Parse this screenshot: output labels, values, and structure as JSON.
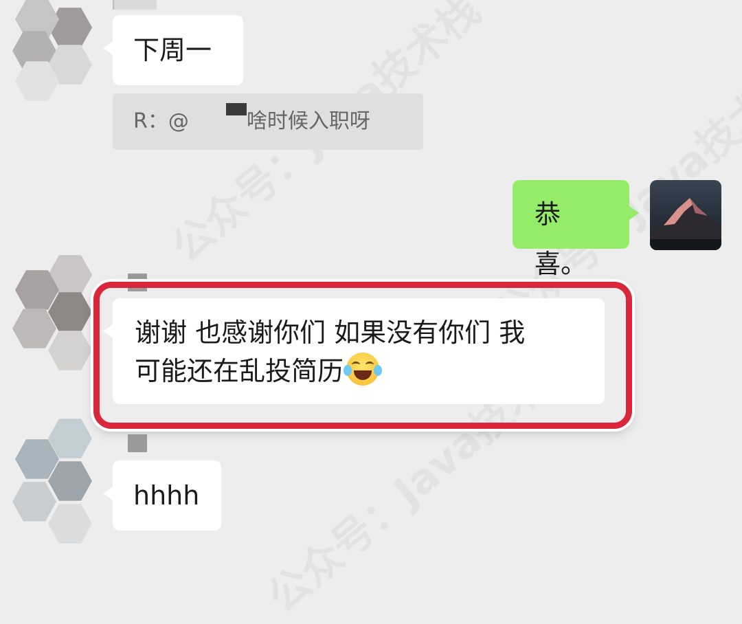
{
  "watermark": {
    "text": "公众号：Java技术栈"
  },
  "messages": {
    "msg1": {
      "text": "下周一"
    },
    "quote": {
      "prefix": "R：@",
      "text": "啥时候入职呀"
    },
    "msg2": {
      "text": "恭喜。"
    },
    "msg3": {
      "line1": "谢谢  也感谢你们  如果没有你们 我",
      "line2": "可能还在乱投简历",
      "emoji": "laughing-with-tears-emoji"
    },
    "msg4": {
      "text": "hhhh"
    }
  },
  "colors": {
    "background": "#ededed",
    "sent_bubble": "#95ec69",
    "received_bubble": "#ffffff",
    "highlight": "#d9263b"
  }
}
